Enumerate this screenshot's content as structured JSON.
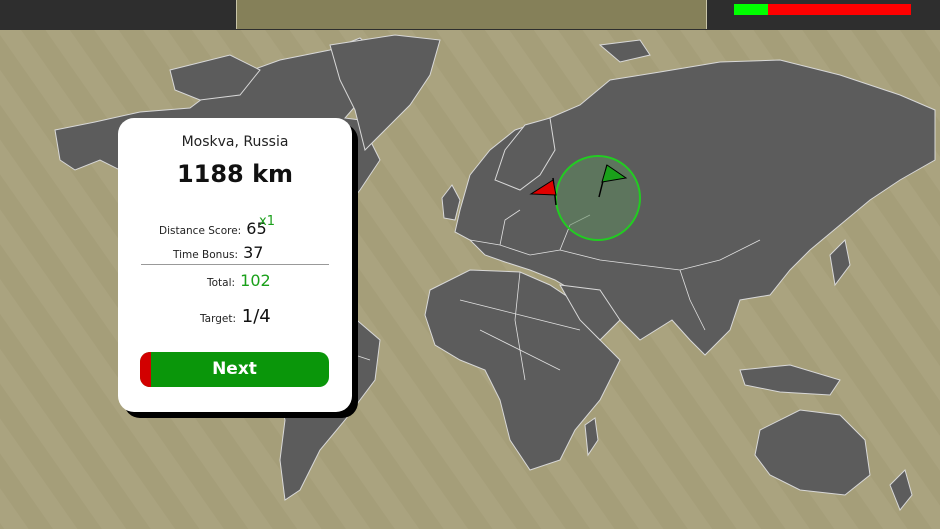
{
  "timer": {
    "remaining_fraction": 0.19
  },
  "result_card": {
    "city": "Moskva, Russia",
    "distance": "1188 km",
    "distance_score_label": "Distance Score:",
    "distance_score": "65",
    "multiplier": "x1",
    "time_bonus_label": "Time Bonus:",
    "time_bonus": "37",
    "total_label": "Total:",
    "total": "102",
    "target_label": "Target:",
    "target": "1/4",
    "next_label": "Next"
  },
  "colors": {
    "accent_green": "#0a960a",
    "guess_flag": "#e00000",
    "target_flag": "#1aa01a",
    "map_land": "#5a5a5a",
    "map_water": "#a9a27e"
  }
}
